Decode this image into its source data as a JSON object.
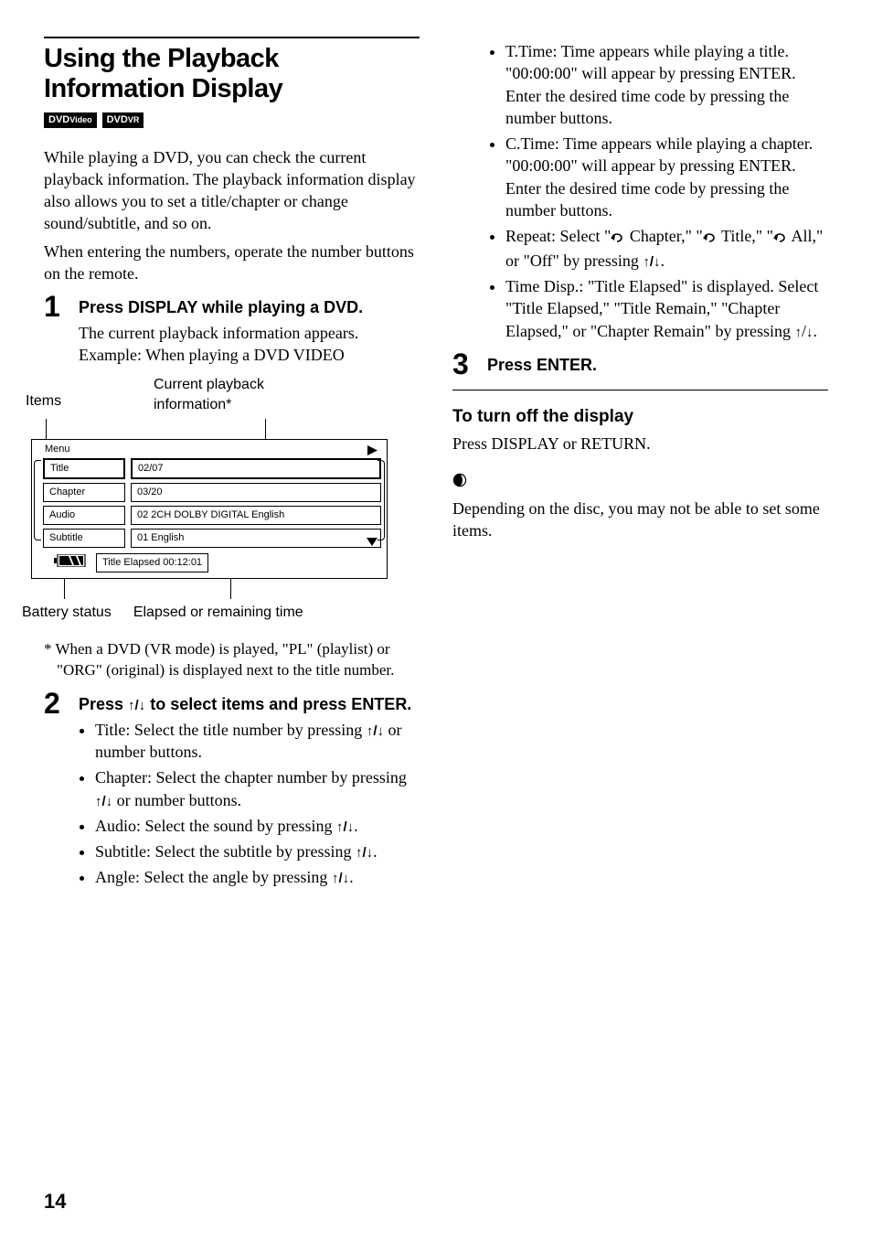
{
  "title": "Using the Playback Information Display",
  "badges": [
    {
      "main": "DVD",
      "sub": "Video"
    },
    {
      "main": "DVD",
      "sub": "VR"
    }
  ],
  "intro_p1": "While playing a DVD, you can check the current playback information. The playback information display also allows you to set a title/chapter or change sound/subtitle, and so on.",
  "intro_p2": "When entering the numbers, operate the number buttons on the remote.",
  "step1": {
    "head": "Press DISPLAY while playing a DVD.",
    "body1": "The current playback information appears.",
    "body2": "Example: When playing a DVD VIDEO"
  },
  "diagram": {
    "label_items": "Items",
    "label_info_l1": "Current playback",
    "label_info_l2": "information*",
    "menu": "Menu",
    "rows": [
      {
        "l": "Title",
        "r": "02/07"
      },
      {
        "l": "Chapter",
        "r": "03/20"
      },
      {
        "l": "Audio",
        "r": "02 2CH DOLBY DIGITAL English"
      },
      {
        "l": "Subtitle",
        "r": "01 English"
      }
    ],
    "elapsed": "Title Elapsed 00:12:01",
    "label_battery": "Battery status",
    "label_elapsed": "Elapsed or remaining time"
  },
  "footnote": "* When a DVD (VR mode) is played, \"PL\" (playlist) or \"ORG\" (original) is displayed next to the title number.",
  "step2": {
    "head_pre": "Press ",
    "head_post": " to select items and press ENTER.",
    "bullets_col1": {
      "title_pre": "Title: Select the title number by pressing ",
      "title_post": " or number buttons.",
      "chapter_pre": "Chapter: Select the chapter number by pressing ",
      "chapter_post": " or number buttons.",
      "audio_pre": "Audio: Select the sound by pressing ",
      "audio_post": ".",
      "subtitle_pre": "Subtitle: Select the subtitle by pressing ",
      "subtitle_post": ".",
      "angle_pre": "Angle: Select the angle by pressing ",
      "angle_post": "."
    },
    "bullets_col2": {
      "ttime": "T.Time: Time appears while playing a title. \"00:00:00\" will appear by pressing ENTER. Enter the desired time code by pressing the number buttons.",
      "ctime": "C.Time: Time appears while playing a chapter. \"00:00:00\" will appear by pressing ENTER. Enter the desired time code by pressing the number buttons.",
      "repeat_pre": "Repeat: Select \"",
      "repeat_chap": " Chapter,\" \"",
      "repeat_title": " Title,\" \"",
      "repeat_all": " All,\" or \"Off\" by pressing ",
      "repeat_post": ".",
      "timedisp_pre": "Time Disp.: \"Title Elapsed\" is displayed. Select \"Title Elapsed,\" \"Title Remain,\" \"Chapter Elapsed,\" or \"Chapter Remain\" by pressing ",
      "timedisp_post": "."
    }
  },
  "step3": {
    "head": "Press ENTER."
  },
  "turnoff": {
    "head": "To turn off the display",
    "body": "Press DISPLAY or RETURN."
  },
  "note": "Depending on the disc, you may not be able to set some items.",
  "arrows": "↑/↓",
  "arrow_up": "↑",
  "arrow_dn": "↓",
  "pagenum": "14"
}
